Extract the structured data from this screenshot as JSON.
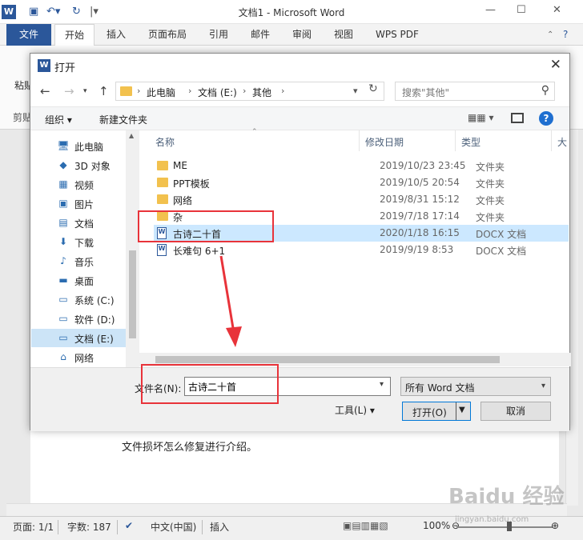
{
  "word": {
    "logo": "W",
    "title": "文档1 - Microsoft Word",
    "file_tab": "文件",
    "tabs": [
      "开始",
      "插入",
      "页面布局",
      "引用",
      "邮件",
      "审阅",
      "视图",
      "WPS PDF"
    ],
    "paste_label": "粘贴",
    "clipboard_label": "剪贴",
    "doc_text": "文件损坏怎么修复进行介绍。",
    "status": {
      "page": "页面: 1/1",
      "words": "字数: 187",
      "language": "中文(中国)",
      "mode": "插入",
      "zoom": "100%"
    }
  },
  "dialog": {
    "icon": "W",
    "title": "打开",
    "breadcrumb": [
      "此电脑",
      "文档 (E:)",
      "其他"
    ],
    "search_placeholder": "搜索\"其他\"",
    "toolbar": {
      "organize": "组织 ▾",
      "new_folder": "新建文件夹"
    },
    "nav_items": [
      {
        "label": "此电脑",
        "icon": "pc-icon",
        "glyph": "🖥"
      },
      {
        "label": "3D 对象",
        "icon": "cube-icon",
        "glyph": "◆"
      },
      {
        "label": "视频",
        "icon": "video-icon",
        "glyph": "▦"
      },
      {
        "label": "图片",
        "icon": "picture-icon",
        "glyph": "▣"
      },
      {
        "label": "文档",
        "icon": "document-icon",
        "glyph": "▤"
      },
      {
        "label": "下载",
        "icon": "download-icon",
        "glyph": "⬇"
      },
      {
        "label": "音乐",
        "icon": "music-icon",
        "glyph": "♪"
      },
      {
        "label": "桌面",
        "icon": "desktop-icon",
        "glyph": "▬"
      },
      {
        "label": "系统 (C:)",
        "icon": "drive-icon",
        "glyph": "▭"
      },
      {
        "label": "软件 (D:)",
        "icon": "drive-icon",
        "glyph": "▭"
      },
      {
        "label": "文档 (E:)",
        "icon": "drive-icon",
        "glyph": "▭"
      },
      {
        "label": "网络",
        "icon": "network-icon",
        "glyph": "⌂"
      }
    ],
    "selected_nav": "文档 (E:)",
    "columns": {
      "name": "名称",
      "date": "修改日期",
      "type": "类型",
      "size": "大"
    },
    "files": [
      {
        "name": "ME",
        "date": "2019/10/23 23:45",
        "type": "文件夹",
        "kind": "folder"
      },
      {
        "name": "PPT模板",
        "date": "2019/10/5 20:54",
        "type": "文件夹",
        "kind": "folder"
      },
      {
        "name": "网络",
        "date": "2019/8/31 15:12",
        "type": "文件夹",
        "kind": "folder"
      },
      {
        "name": "杂",
        "date": "2019/7/18 17:14",
        "type": "文件夹",
        "kind": "folder"
      },
      {
        "name": "古诗二十首",
        "date": "2020/1/18 16:15",
        "type": "DOCX 文档",
        "kind": "docx"
      },
      {
        "name": "长难句 6+1",
        "date": "2019/9/19 8:53",
        "type": "DOCX 文档",
        "kind": "docx"
      }
    ],
    "selected_file": "古诗二十首",
    "filename_label": "文件名(N):",
    "filename_value": "古诗二十首",
    "filter": "所有 Word 文档",
    "tools": "工具(L)",
    "open": "打开(O)",
    "cancel": "取消"
  },
  "colors": {
    "word_blue": "#2b579a",
    "selection": "#cce8ff",
    "annotation_red": "#e8333a"
  },
  "watermark": {
    "brand": "Baidu 经验",
    "url": "jingyan.baidu.com"
  }
}
